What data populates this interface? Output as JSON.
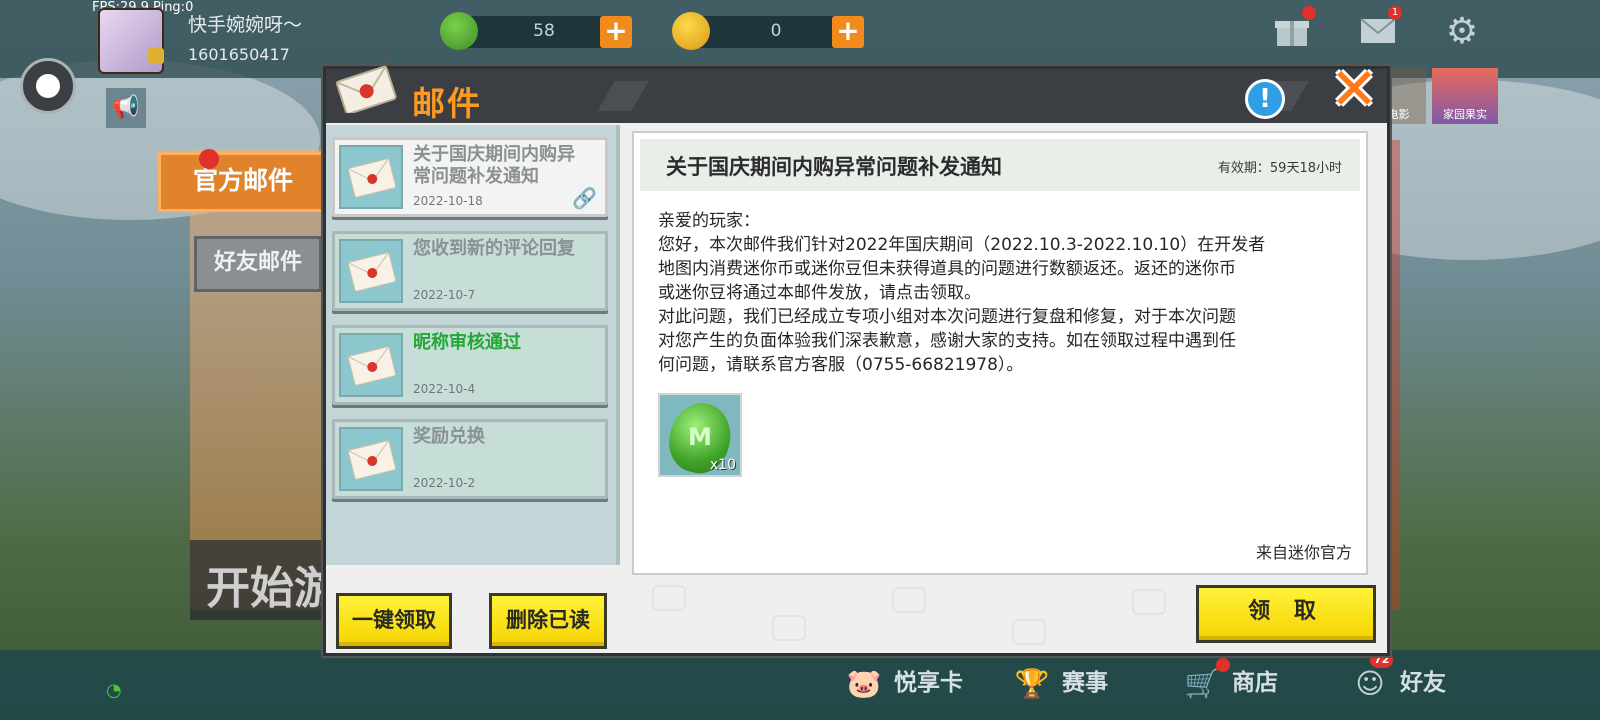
{
  "debug": {
    "fps_text": "FPS:29.9  Ping:0"
  },
  "player": {
    "nickname": "快手婉婉呀～",
    "uid": "1601650417"
  },
  "currencies": [
    {
      "name": "mini-bean",
      "value": "58"
    },
    {
      "name": "mini-coin",
      "value": "0"
    }
  ],
  "top_icons": {
    "gift": "gift-icon",
    "mail": "mail-icon",
    "mail_badge": "1",
    "settings": "gear-icon"
  },
  "side_tiles": {
    "movie": "大电影",
    "fruit": "家园果实"
  },
  "side_tabs": {
    "official": "官方邮件",
    "friend": "好友邮件"
  },
  "background": {
    "start_text": "开始游"
  },
  "dialog": {
    "title": "邮件",
    "info_symbol": "!",
    "close_symbol": "✕"
  },
  "mail_list": [
    {
      "subject": "关于国庆期间内购异常问题补发通知",
      "date": "2022-10-18",
      "selected": true,
      "has_attachment": true
    },
    {
      "subject": "您收到新的评论回复",
      "date": "2022-10-7",
      "selected": false,
      "has_attachment": false
    },
    {
      "subject": "昵称审核通过",
      "date": "2022-10-4",
      "selected": false,
      "has_attachment": false,
      "highlight_color": "#23a835"
    },
    {
      "subject": "奖励兑换",
      "date": "2022-10-2",
      "selected": false,
      "has_attachment": false
    }
  ],
  "list_buttons": {
    "claim_all": "一键领取",
    "delete_read": "删除已读"
  },
  "mail_detail": {
    "title": "关于国庆期间内购异常问题补发通知",
    "validity": "有效期：59天18小时",
    "greeting": "亲爱的玩家：",
    "body_lines": [
      "您好，本次邮件我们针对2022年国庆期间（2022.10.3-2022.10.10）在开发者",
      "地图内消费迷你币或迷你豆但未获得道具的问题进行数额返还。返还的迷你币",
      "或迷你豆将通过本邮件发放，请点击领取。",
      "对此问题，我们已经成立专项小组对本次问题进行复盘和修复，对于本次问题",
      "对您产生的负面体验我们深表歉意，感谢大家的支持。如在领取过程中遇到任",
      "何问题，请联系官方客服（0755-66821978）。"
    ],
    "attachment": {
      "icon": "mini-bean-icon",
      "quantity": "x10"
    },
    "sender": "来自迷你官方",
    "claim_button": "领 取"
  },
  "bottom_nav": [
    {
      "label": "悦享卡",
      "icon": "pig-card-icon"
    },
    {
      "label": "赛事",
      "icon": "trophy-icon"
    },
    {
      "label": "商店",
      "icon": "cart-icon"
    },
    {
      "label": "好友",
      "icon": "friends-icon",
      "badge": "72"
    }
  ],
  "colors": {
    "accent_orange": "#ff9a1e",
    "button_yellow": "#f5d400",
    "info_blue": "#2f9ee4"
  }
}
